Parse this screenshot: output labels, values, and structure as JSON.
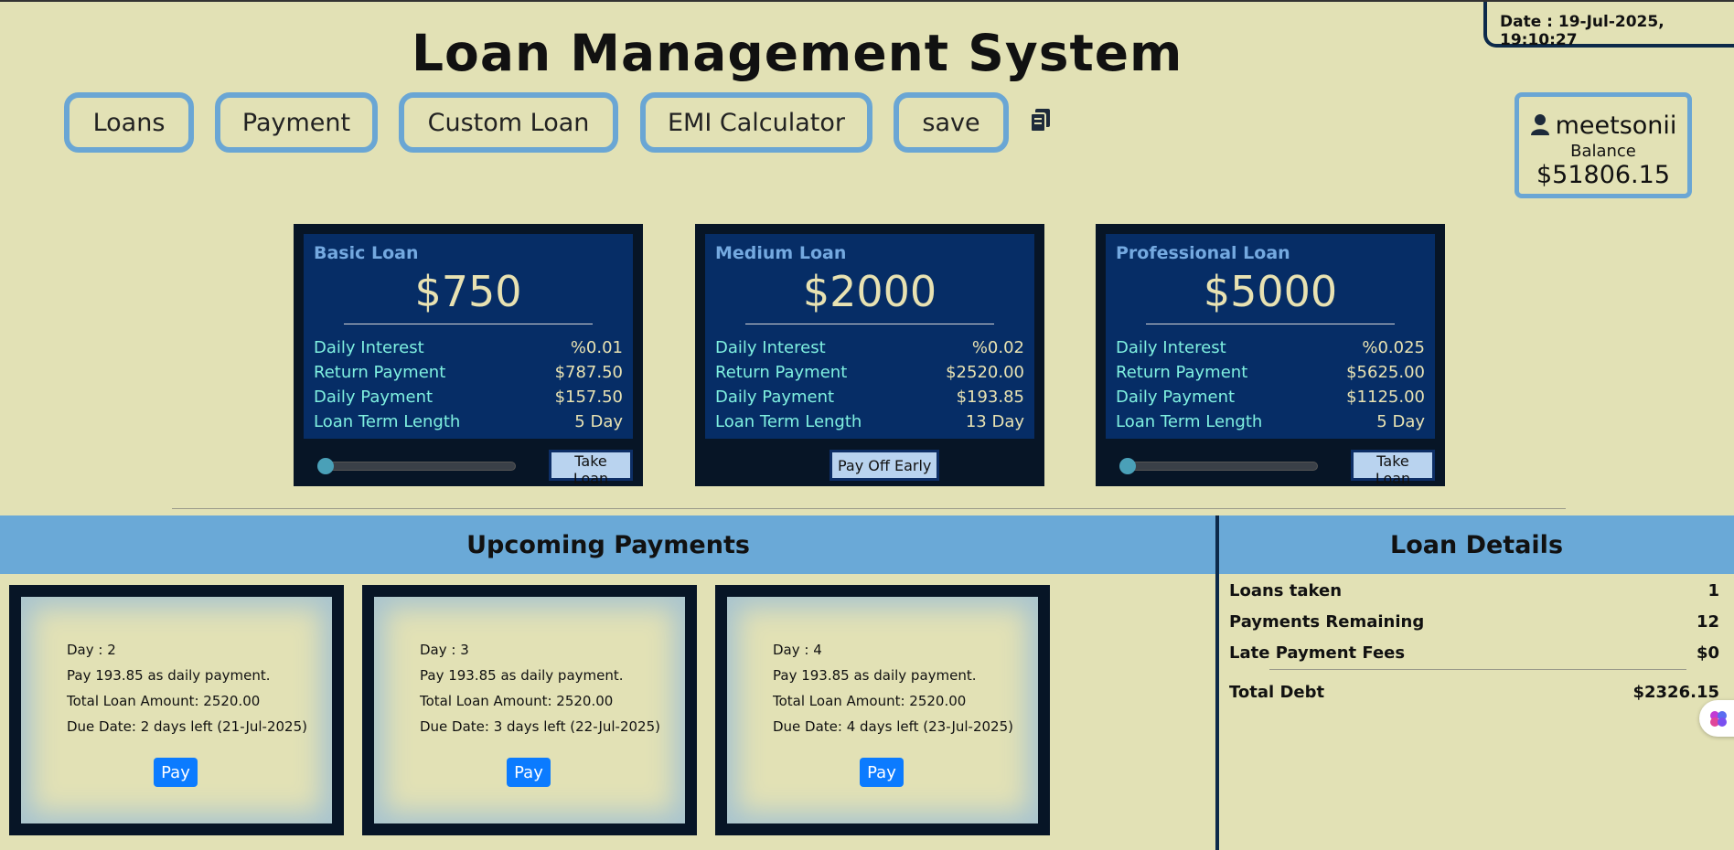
{
  "date_text": "Date : 19-Jul-2025, 19:10:27",
  "title": "Loan Management System",
  "nav": {
    "loans": "Loans",
    "payment": "Payment",
    "custom_loan": "Custom Loan",
    "emi_calculator": "EMI Calculator",
    "save": "save"
  },
  "user": {
    "name": "meetsonii",
    "balance_label": "Balance",
    "balance": "$51806.15"
  },
  "loan_cards": [
    {
      "title": "Basic Loan",
      "amount": "$750",
      "rows": [
        {
          "label": "Daily Interest",
          "value": "%0.01"
        },
        {
          "label": "Return Payment",
          "value": "$787.50"
        },
        {
          "label": "Daily Payment",
          "value": "$157.50"
        },
        {
          "label": "Loan Term Length",
          "value": "5 Day"
        }
      ],
      "button": "Take Loan"
    },
    {
      "title": "Medium Loan",
      "amount": "$2000",
      "rows": [
        {
          "label": "Daily Interest",
          "value": "%0.02"
        },
        {
          "label": "Return Payment",
          "value": "$2520.00"
        },
        {
          "label": "Daily Payment",
          "value": "$193.85"
        },
        {
          "label": "Loan Term Length",
          "value": "13 Day"
        }
      ],
      "button": "Pay Off Early"
    },
    {
      "title": "Professional Loan",
      "amount": "$5000",
      "rows": [
        {
          "label": "Daily Interest",
          "value": "%0.025"
        },
        {
          "label": "Return Payment",
          "value": "$5625.00"
        },
        {
          "label": "Daily Payment",
          "value": "$1125.00"
        },
        {
          "label": "Loan Term Length",
          "value": "5 Day"
        }
      ],
      "button": "Take Loan"
    }
  ],
  "upcoming_header": "Upcoming Payments",
  "upcoming": [
    {
      "day": "Day : 2",
      "pay": "Pay 193.85 as daily payment.",
      "total": "Total Loan Amount: 2520.00",
      "due": "Due Date: 2 days left (21-Jul-2025)",
      "button": "Pay"
    },
    {
      "day": "Day : 3",
      "pay": "Pay 193.85 as daily payment.",
      "total": "Total Loan Amount: 2520.00",
      "due": "Due Date: 3 days left (22-Jul-2025)",
      "button": "Pay"
    },
    {
      "day": "Day : 4",
      "pay": "Pay 193.85 as daily payment.",
      "total": "Total Loan Amount: 2520.00",
      "due": "Due Date: 4 days left (23-Jul-2025)",
      "button": "Pay"
    }
  ],
  "loan_details": {
    "header": "Loan Details",
    "loans_taken_label": "Loans taken",
    "loans_taken_value": "1",
    "payments_remaining_label": "Payments Remaining",
    "payments_remaining_value": "12",
    "late_fees_label": "Late Payment Fees",
    "late_fees_value": "$0",
    "total_debt_label": "Total Debt",
    "total_debt_value": "$2326.15"
  },
  "icons": {
    "doc": "document-copy-icon",
    "user": "user-icon",
    "fab": "brain-icon"
  },
  "colors": {
    "background": "#e2e1b5",
    "accent_border": "#6aa6d4",
    "card_bg": "#062d66",
    "pay_button": "#0b7bff"
  }
}
